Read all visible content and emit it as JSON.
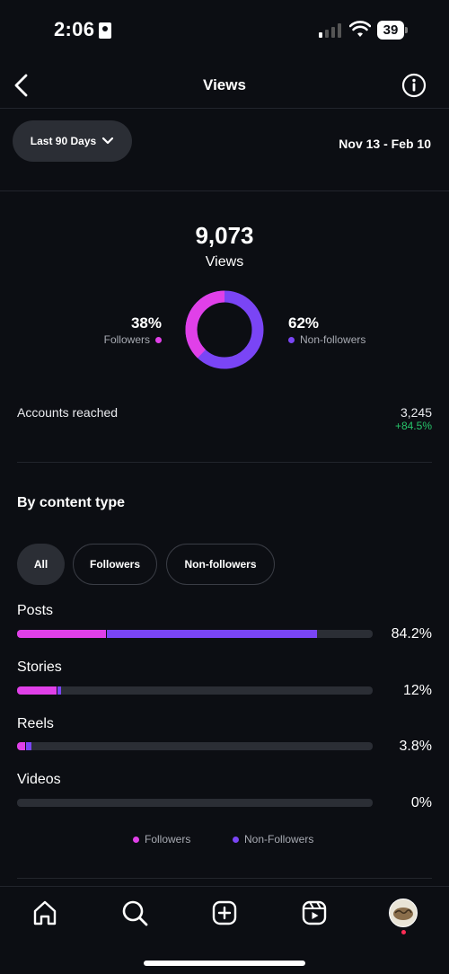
{
  "status_bar": {
    "time": "2:06",
    "battery": "39"
  },
  "header": {
    "title": "Views"
  },
  "filter": {
    "range_label": "Last 90 Days",
    "date_range": "Nov 13 - Feb 10"
  },
  "summary": {
    "total": "9,073",
    "total_label": "Views",
    "followers_pct": "38%",
    "followers_label": "Followers",
    "non_followers_pct": "62%",
    "non_followers_label": "Non-followers",
    "followers_fraction": 0.38
  },
  "accounts": {
    "label": "Accounts reached",
    "value": "3,245",
    "change": "+84.5%"
  },
  "content": {
    "title": "By content type",
    "tabs": [
      "All",
      "Followers",
      "Non-followers"
    ],
    "rows": [
      {
        "label": "Posts",
        "value": "84.2%",
        "followers": 25.0,
        "non_followers": 59.2
      },
      {
        "label": "Stories",
        "value": "12%",
        "followers": 11.0,
        "non_followers": 1.0
      },
      {
        "label": "Reels",
        "value": "3.8%",
        "followers": 2.3,
        "non_followers": 1.5
      },
      {
        "label": "Videos",
        "value": "0%",
        "followers": 0,
        "non_followers": 0
      }
    ],
    "legend": {
      "followers": "Followers",
      "non_followers": "Non-Followers"
    }
  },
  "colors": {
    "followers": "#e040e8",
    "non_followers": "#7a45f5",
    "positive": "#27c46a"
  },
  "nav": [
    "home-icon",
    "search-icon",
    "create-icon",
    "reels-icon",
    "profile-avatar"
  ]
}
